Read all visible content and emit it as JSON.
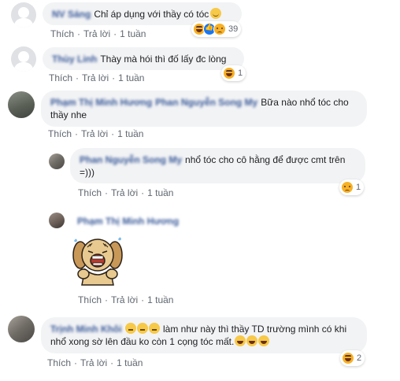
{
  "comments": [
    {
      "author": "NV Sáng",
      "text": "Chỉ áp dụng với thầy có tóc",
      "actions": {
        "like": "Thích",
        "reply": "Trả lời",
        "time": "1 tuần"
      },
      "reaction_count": "39"
    },
    {
      "author": "Thùy Linh",
      "text": "Thày mà hói thì đố lấy đc lòng",
      "actions": {
        "like": "Thích",
        "reply": "Trả lời",
        "time": "1 tuần"
      },
      "reaction_count": "1"
    },
    {
      "author": "Phạm Thị Minh Hương",
      "mention": "Phan Nguyễn Song My",
      "text": "Bữa nào nhổ tóc cho thầy nhe",
      "actions": {
        "like": "Thích",
        "reply": "Trả lời",
        "time": "1 tuần"
      },
      "replies": [
        {
          "author": "Phan Nguyễn Song My",
          "text": "nhổ tóc cho cô hằng để được cmt trên =)))",
          "actions": {
            "like": "Thích",
            "reply": "Trả lời",
            "time": "1 tuần"
          },
          "reaction_count": "1"
        },
        {
          "author": "Phạm Thị Minh Hương",
          "actions": {
            "like": "Thích",
            "reply": "Trả lời",
            "time": "1 tuần"
          }
        }
      ]
    },
    {
      "author": "Trịnh Minh Khôi",
      "text": "làm như này thì thầy TD trường mình có khi nhổ xong sờ lên đầu ko còn 1 cọng tóc mất.",
      "actions": {
        "like": "Thích",
        "reply": "Trả lời",
        "time": "1 tuần"
      },
      "reaction_count": "2"
    }
  ]
}
